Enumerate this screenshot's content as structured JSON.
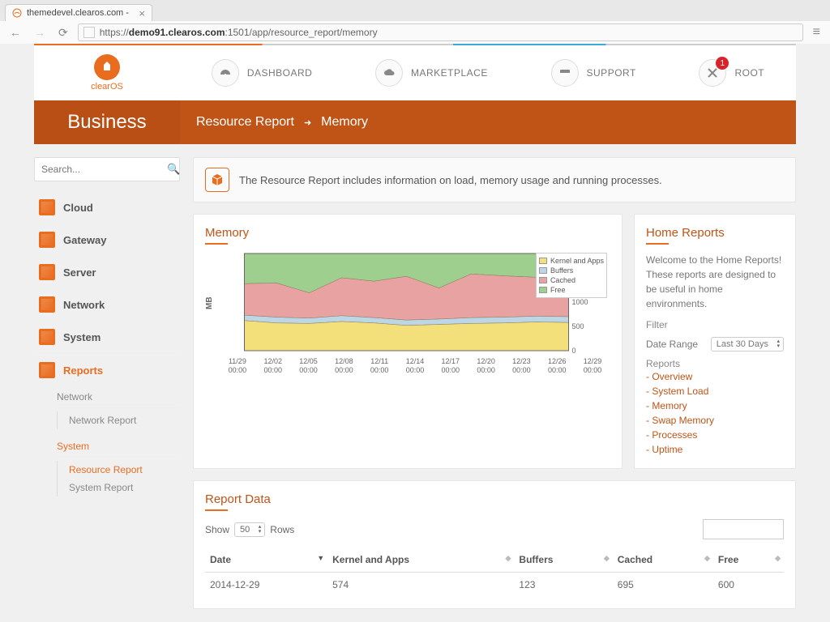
{
  "browser": {
    "tab_title": "themedevel.clearos.com -",
    "url_prefix": "https://",
    "url_host": "demo91.clearos.com",
    "url_port_path": ":1501/app/resource_report/memory"
  },
  "brand": {
    "name": "clearOS"
  },
  "nav": {
    "dashboard": "DASHBOARD",
    "marketplace": "MARKETPLACE",
    "support": "SUPPORT",
    "root": "ROOT",
    "badge": "1"
  },
  "orange": {
    "section": "Business",
    "crumb1": "Resource Report",
    "crumb2": "Memory"
  },
  "search": {
    "placeholder": "Search..."
  },
  "sidebar": {
    "items": [
      "Cloud",
      "Gateway",
      "Server",
      "Network",
      "System",
      "Reports"
    ],
    "tree": {
      "network_head": "Network",
      "network_report": "Network Report",
      "system_head": "System",
      "resource_report": "Resource Report",
      "system_report": "System Report"
    }
  },
  "info": "The Resource Report includes information on load, memory usage and running processes.",
  "chart_panel_title": "Memory",
  "home_panel": {
    "title": "Home Reports",
    "welcome": "Welcome to the Home Reports! These reports are designed to be useful in home environments.",
    "filter_label": "Filter",
    "date_range_label": "Date Range",
    "date_range_value": "Last 30 Days",
    "reports_label": "Reports",
    "links": [
      "Overview",
      "System Load",
      "Memory",
      "Swap Memory",
      "Processes",
      "Uptime"
    ]
  },
  "chart_data": {
    "type": "area",
    "ylabel": "MB",
    "ylim": [
      0,
      2000
    ],
    "yticks": [
      0,
      500,
      1000,
      1500
    ],
    "categories": [
      "11/29",
      "12/02",
      "12/05",
      "12/08",
      "12/11",
      "12/14",
      "12/17",
      "12/20",
      "12/23",
      "12/26",
      "12/29"
    ],
    "x_sublabel": "00:00",
    "series": [
      {
        "name": "Kernel and Apps",
        "color": "#f4e07a",
        "values": [
          620,
          570,
          560,
          600,
          570,
          520,
          540,
          560,
          570,
          590,
          580
        ]
      },
      {
        "name": "Buffers",
        "color": "#bcd6e6",
        "values": [
          110,
          120,
          110,
          120,
          110,
          110,
          110,
          120,
          120,
          120,
          120
        ]
      },
      {
        "name": "Cached",
        "color": "#e9a2a2",
        "values": [
          650,
          700,
          520,
          780,
          750,
          900,
          640,
          900,
          850,
          800,
          700
        ]
      },
      {
        "name": "Free",
        "color": "#9fcf8f",
        "values": [
          620,
          610,
          810,
          500,
          570,
          470,
          710,
          420,
          460,
          490,
          600
        ]
      }
    ]
  },
  "report_data": {
    "title": "Report Data",
    "show": "Show",
    "rows_label": "Rows",
    "page_size": "50",
    "columns": [
      "Date",
      "Kernel and Apps",
      "Buffers",
      "Cached",
      "Free"
    ],
    "rows": [
      {
        "date": "2014-12-29",
        "kapps": "574",
        "buffers": "123",
        "cached": "695",
        "free": "600"
      }
    ]
  }
}
